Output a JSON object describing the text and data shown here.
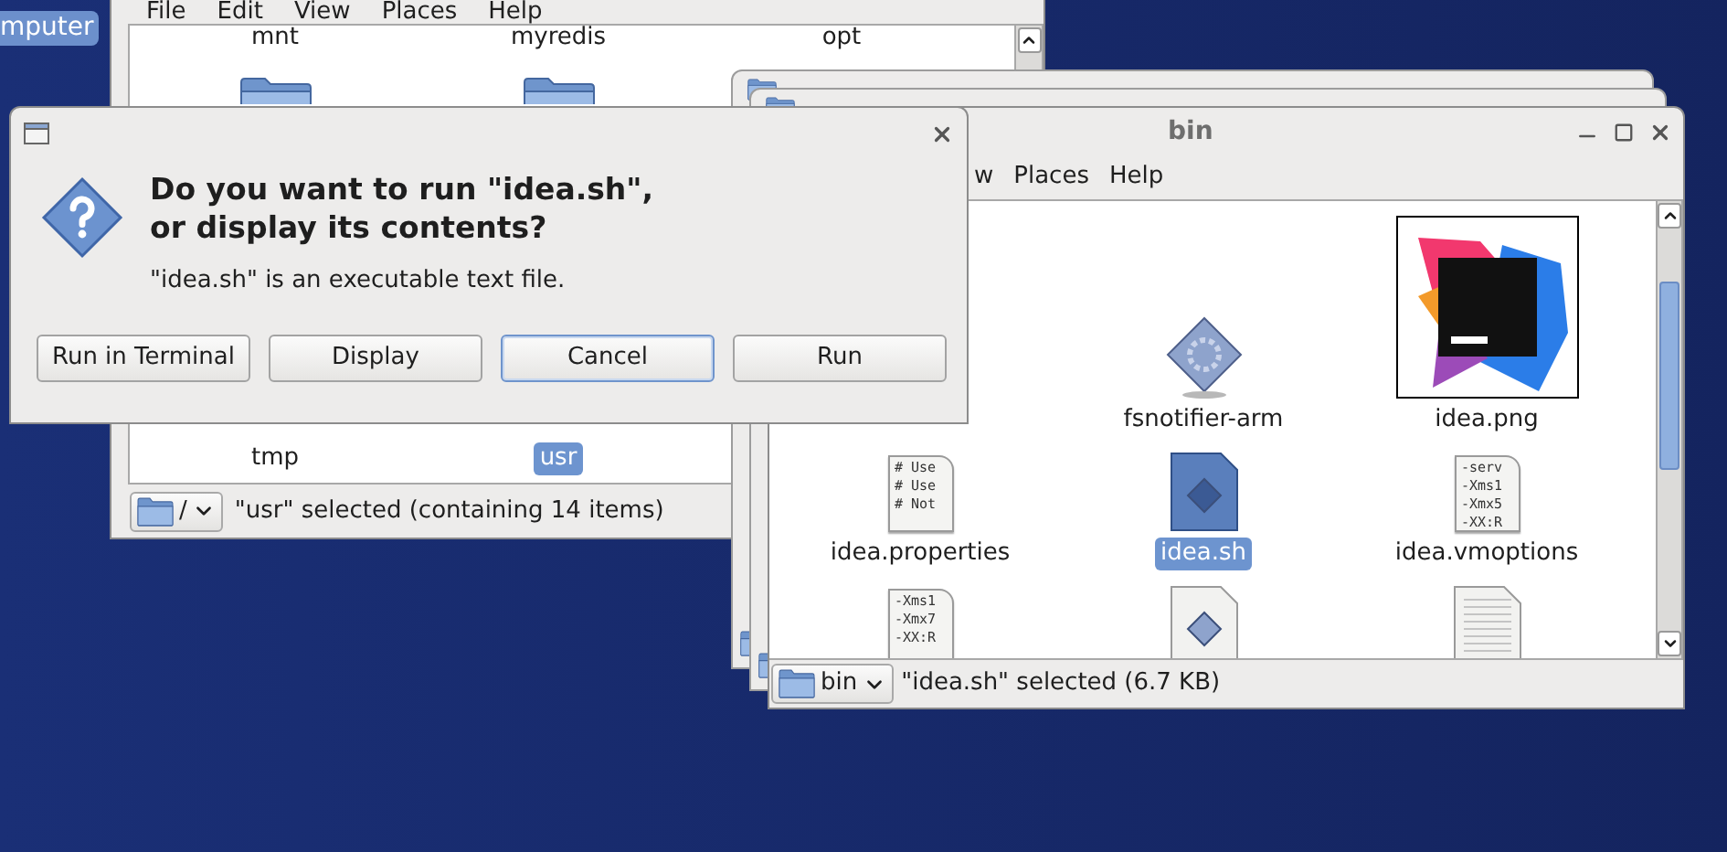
{
  "desktop": {
    "icon_label": "mputer"
  },
  "back_window": {
    "menu": [
      "File",
      "Edit",
      "View",
      "Places",
      "Help"
    ],
    "top_labels": [
      "mnt",
      "myredis",
      "opt"
    ],
    "bottom_items": [
      {
        "label": "tmp",
        "selected": false
      },
      {
        "label": "usr",
        "selected": true
      }
    ],
    "location": "/",
    "status": "\"usr\" selected (containing 14 items)"
  },
  "front_window": {
    "title": "bin",
    "menu": [
      "w",
      "Places",
      "Help"
    ],
    "rows": [
      {
        "items": [
          {
            "kind": "executable",
            "label": "fsnotifier-arm",
            "selected": false
          },
          {
            "label": "idea.png",
            "selected": false
          }
        ]
      },
      {
        "items": [
          {
            "kind": "text",
            "label": "idea.properties",
            "selected": false,
            "preview": [
              "# Use",
              "# Use",
              "# Not"
            ]
          },
          {
            "kind": "script",
            "label": "idea.sh",
            "selected": true
          },
          {
            "kind": "text",
            "label": "idea.vmoptions",
            "selected": false,
            "preview": [
              "-serv",
              "-Xms1",
              "-Xmx5",
              "-XX:R"
            ]
          }
        ]
      },
      {
        "items": [
          {
            "kind": "text",
            "preview": [
              "-Xms1",
              "-Xmx7",
              "-XX:R"
            ]
          },
          {
            "kind": "script",
            "selected": false
          },
          {
            "kind": "document"
          }
        ]
      }
    ],
    "location": "bin",
    "status": "\"idea.sh\" selected (6.7 KB)"
  },
  "dialog": {
    "heading_lines": [
      "Do you want to run \"idea.sh\",",
      "or display its contents?"
    ],
    "message": "\"idea.sh\" is an executable text file.",
    "buttons": [
      {
        "label": "Run in Terminal",
        "focused": false
      },
      {
        "label": "Display",
        "focused": false
      },
      {
        "label": "Cancel",
        "focused": true
      },
      {
        "label": "Run",
        "focused": false
      }
    ]
  }
}
